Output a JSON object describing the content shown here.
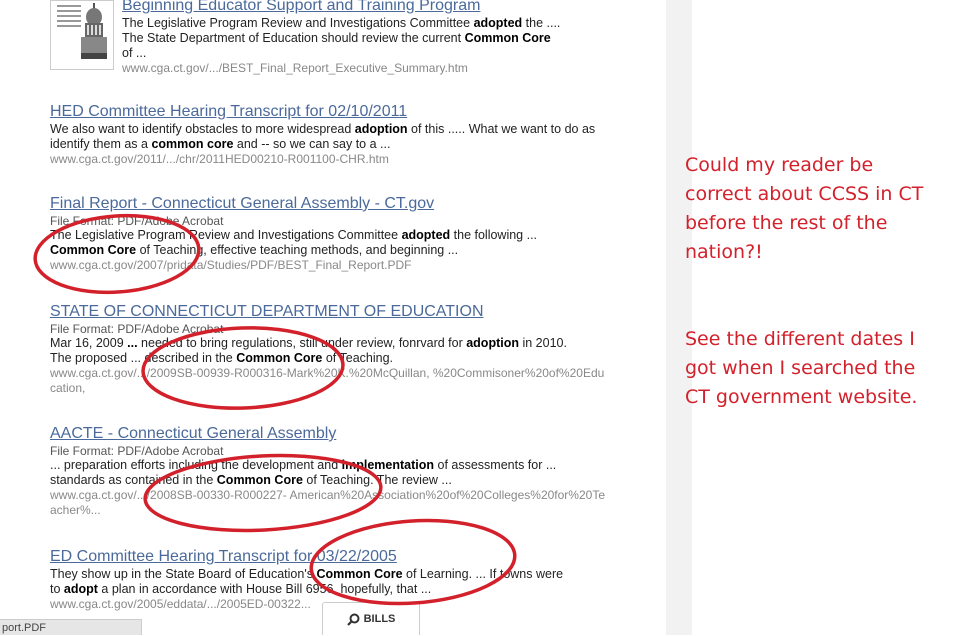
{
  "results": [
    {
      "title": "Beginning Educator Support and Training Program",
      "snippet_html": "The Legislative Program Review and Investigations Committee <b>adopted</b> the ....<br>The State Department of Education should review the current <b>Common Core</b><br>of ...",
      "url": "www.cga.ct.gov/.../BEST_Final_Report_Executive_Summary.htm"
    },
    {
      "title": "HED Committee Hearing Transcript for 02/10/2011",
      "snippet_html": "We also want to identify obstacles to more widespread <b>adoption</b> of this ..... What we want to do as identify them as a <b>common core</b> and -- so we can say to a ...",
      "url": "www.cga.ct.gov/2011/.../chr/2011HED00210-R001100-CHR.htm"
    },
    {
      "title": "Final Report - Connecticut General Assembly - CT.gov",
      "format": "File Format: PDF/Adobe Acrobat",
      "snippet_html": "The Legislative Program Review and Investigations Committee <b>adopted</b> the following ...<br><b>Common Core</b> of Teaching, effective teaching methods, and beginning ...",
      "url": "www.cga.ct.gov/2007/pridata/Studies/PDF/BEST_Final_Report.PDF"
    },
    {
      "title": "STATE OF CONNECTICUT DEPARTMENT OF EDUCATION",
      "format": "File Format: PDF/Adobe Acrobat",
      "snippet_html": "Mar 16, 2009 <b>...</b> needed to bring regulations, still under review, fonrvard for <b>adoption</b> in 2010.<br>The proposed ... described in the <b>Common Core</b> of Teaching.",
      "url": "www.cga.ct.gov/.../2009SB-00939-R000316-Mark%20K.%20McQuillan, %20Commisoner%20of%20Education,"
    },
    {
      "title": "AACTE - Connecticut General Assembly",
      "format": "File Format: PDF/Adobe Acrobat",
      "snippet_html": "... preparation efforts including the development and <b>implementation</b> of assessments for ...<br>standards as contained in the <b>Common Core</b> of Teaching. The review ...",
      "url": "www.cga.ct.gov/.../2008SB-00330-R000227- American%20Association%20of%20Colleges%20for%20Teacher%..."
    },
    {
      "title": "ED Committee Hearing Transcript for 03/22/2005",
      "snippet_html": "They show up in the State Board of Education's <b>Common Core</b> of Learning. ... If towns were<br>to <b>adopt</b> a plan in accordance with House Bill 6956, hopefully, that ...",
      "url": "www.cga.ct.gov/2005/eddata/.../2005ED-00322..."
    }
  ],
  "annotations": {
    "note1": "Could my reader be correct about CCSS in CT before the rest of the nation?!",
    "note2": "See the different dates I got when I searched the CT government website.",
    "color": "#d3212c"
  },
  "status_bar": {
    "text": "port.PDF"
  },
  "bills_button": {
    "label": "BILLS",
    "icon": "search-icon"
  }
}
